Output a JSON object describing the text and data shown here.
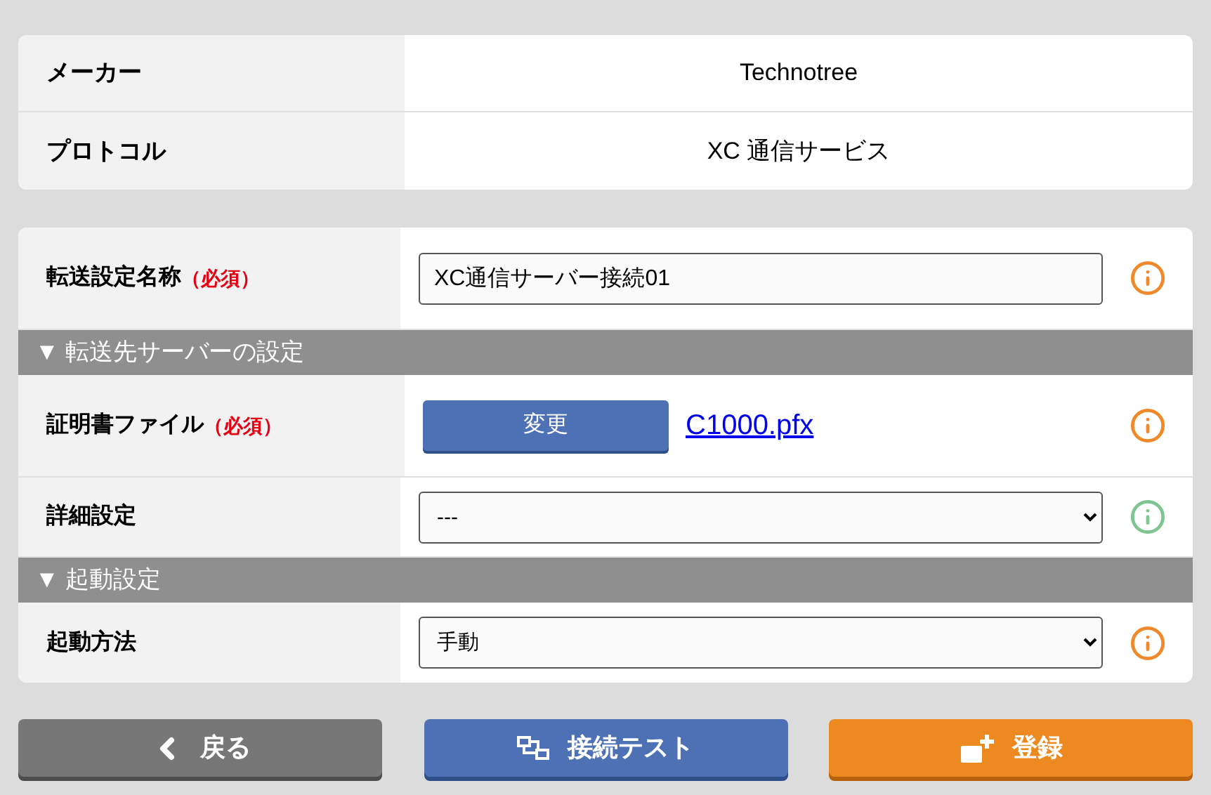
{
  "info_table": [
    {
      "label": "メーカー",
      "value": "Technotree"
    },
    {
      "label": "プロトコル",
      "value": "XC 通信サービス"
    }
  ],
  "settings": [
    {
      "kind": "input",
      "label": "転送設定名称",
      "required": "（必須）",
      "value": "XC通信サーバー接続01",
      "color": "#f0892a"
    },
    {
      "kind": "section",
      "label": "▼ 転送先サーバーの設定"
    },
    {
      "kind": "file",
      "label": "証明書ファイル",
      "required": "（必須）",
      "button": "変更",
      "file": "C1000.pfx",
      "color": "#f0892a"
    },
    {
      "kind": "select",
      "label": "詳細設定",
      "value": "---",
      "color": "#7fc592"
    },
    {
      "kind": "section",
      "label": "▼ 起動設定"
    },
    {
      "kind": "select",
      "label": "起動方法",
      "value": "手動",
      "color": "#f0892a"
    }
  ],
  "buttons": [
    {
      "kind": "back",
      "label": "戻る"
    },
    {
      "kind": "test",
      "label": "接続テスト"
    },
    {
      "kind": "register",
      "label": "登録"
    }
  ]
}
